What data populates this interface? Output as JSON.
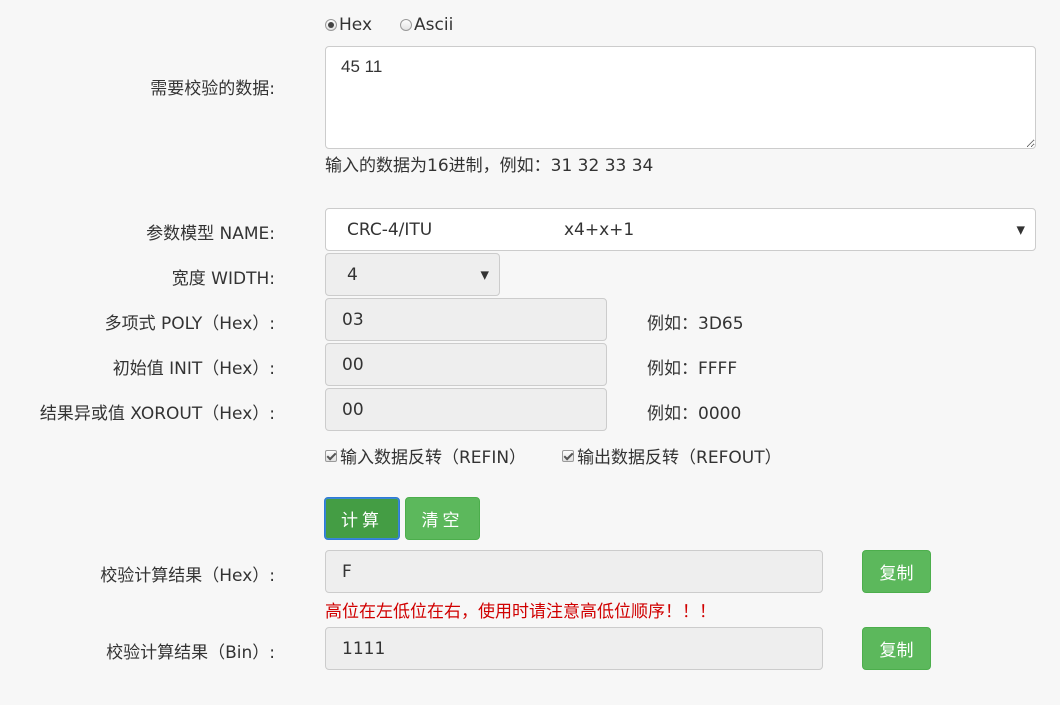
{
  "format_radio": {
    "options": [
      {
        "label": "Hex",
        "selected": true
      },
      {
        "label": "Ascii",
        "selected": false
      }
    ]
  },
  "data_input": {
    "label": "需要校验的数据:",
    "value": "45 11",
    "hint": "输入的数据为16进制，例如：31 32 33 34"
  },
  "model": {
    "label": "参数模型 NAME:",
    "selected_name": "CRC-4/ITU",
    "selected_poly": "x4+x+1"
  },
  "width": {
    "label": "宽度 WIDTH:",
    "value": "4"
  },
  "poly": {
    "label": "多项式 POLY（Hex）:",
    "value": "03",
    "example": "例如：3D65"
  },
  "init": {
    "label": "初始值 INIT（Hex）:",
    "value": "00",
    "example": "例如：FFFF"
  },
  "xorout": {
    "label": "结果异或值 XOROUT（Hex）:",
    "value": "00",
    "example": "例如：0000"
  },
  "checks": {
    "refin": "输入数据反转（REFIN）",
    "refout": "输出数据反转（REFOUT）"
  },
  "buttons": {
    "calculate": "计算",
    "clear": "清空",
    "copy": "复制"
  },
  "result_hex": {
    "label": "校验计算结果（Hex）:",
    "value": "F",
    "warning": "高位在左低位在右，使用时请注意高低位顺序！！！"
  },
  "result_bin": {
    "label": "校验计算结果（Bin）:",
    "value": "1111"
  },
  "colors": {
    "accent_green": "#5cb85c",
    "warning_red": "#d00000"
  }
}
